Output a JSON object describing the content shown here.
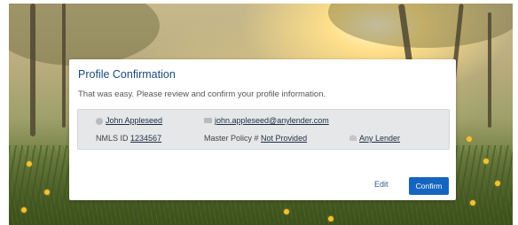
{
  "dialog": {
    "title": "Profile Confirmation",
    "subtitle": "That was easy. Please review and confirm your profile information."
  },
  "profile": {
    "name": "John Appleseed",
    "email": "john.appleseed@anylender.com",
    "nmls_label": "NMLS ID",
    "nmls_value": "1234567",
    "master_policy_label": "Master Policy #",
    "master_policy_value": "Not Provided",
    "lender": "Any Lender"
  },
  "actions": {
    "edit_label": "Edit",
    "confirm_label": "Confirm"
  },
  "colors": {
    "title": "#1a4b7a",
    "primary_button": "#1565c0"
  },
  "icons": [
    "person-icon",
    "mail-icon",
    "bank-icon"
  ]
}
